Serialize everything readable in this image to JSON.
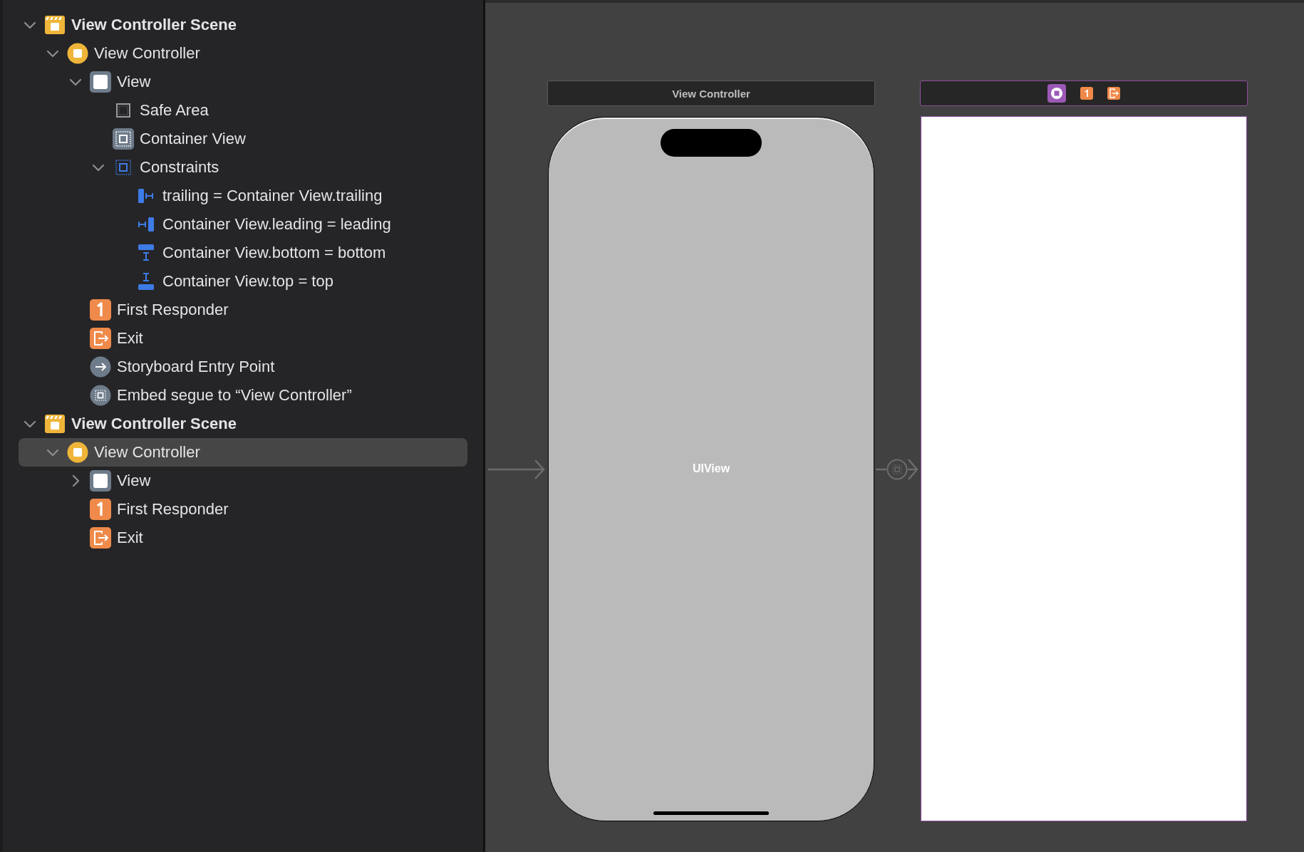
{
  "outline": [
    {
      "label": "View Controller Scene",
      "kind": "scene",
      "expanded": true,
      "selected": false,
      "children": [
        {
          "label": "View Controller",
          "kind": "controller",
          "expanded": true,
          "selected": false,
          "children": [
            {
              "label": "View",
              "kind": "view",
              "expanded": true,
              "selected": false,
              "children": [
                {
                  "label": "Safe Area",
                  "kind": "safe-area",
                  "selected": false
                },
                {
                  "label": "Container View",
                  "kind": "container",
                  "selected": false
                },
                {
                  "label": "Constraints",
                  "kind": "constraints",
                  "expanded": true,
                  "selected": false,
                  "children": [
                    {
                      "label": "trailing = Container View.trailing",
                      "kind": "trailing",
                      "selected": false
                    },
                    {
                      "label": "Container View.leading = leading",
                      "kind": "leading",
                      "selected": false
                    },
                    {
                      "label": "Container View.bottom = bottom",
                      "kind": "bottom",
                      "selected": false
                    },
                    {
                      "label": "Container View.top = top",
                      "kind": "top",
                      "selected": false
                    }
                  ]
                }
              ]
            },
            {
              "label": "First Responder",
              "kind": "responder",
              "selected": false
            },
            {
              "label": "Exit",
              "kind": "exit",
              "selected": false
            },
            {
              "label": "Storyboard Entry Point",
              "kind": "entry",
              "selected": false
            },
            {
              "label": "Embed segue to “View Controller”",
              "kind": "segue",
              "selected": false
            }
          ]
        }
      ]
    },
    {
      "label": "View Controller Scene",
      "kind": "scene",
      "expanded": true,
      "selected": false,
      "children": [
        {
          "label": "View Controller",
          "kind": "controller",
          "expanded": true,
          "selected": true,
          "children": [
            {
              "label": "View",
              "kind": "view",
              "expanded": false,
              "selected": false
            },
            {
              "label": "First Responder",
              "kind": "responder",
              "selected": false
            },
            {
              "label": "Exit",
              "kind": "exit",
              "selected": false
            }
          ]
        }
      ]
    }
  ],
  "canvas": {
    "scenes": [
      {
        "kind": "device",
        "title": "View Controller",
        "content_label": "UIView",
        "selected": false
      },
      {
        "kind": "blank",
        "selected": true
      }
    ]
  }
}
